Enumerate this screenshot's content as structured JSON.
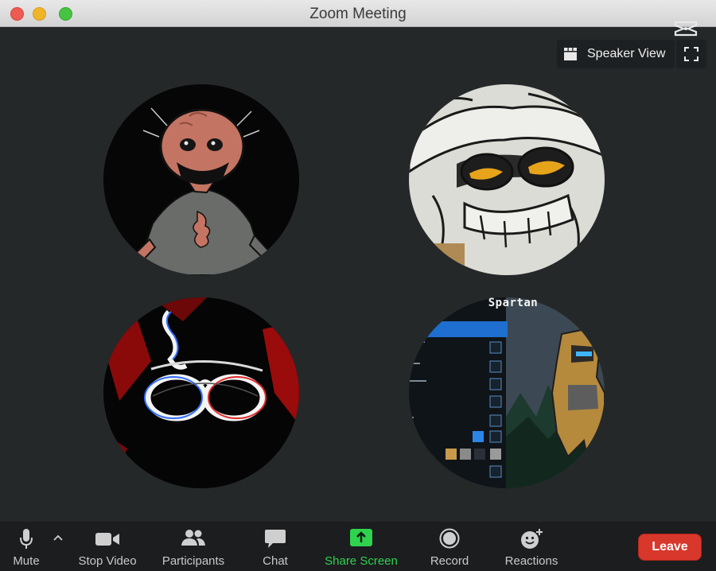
{
  "window": {
    "title": "Zoom Meeting"
  },
  "top_controls": {
    "view_label": "Speaker View"
  },
  "participants": [
    {
      "name": ""
    },
    {
      "name": ""
    },
    {
      "name": ""
    },
    {
      "name": "Spartan"
    }
  ],
  "toolbar": {
    "mute_label": "Mute",
    "video_label": "Stop Video",
    "participants_label": "Participants",
    "chat_label": "Chat",
    "share_label": "Share Screen",
    "record_label": "Record",
    "reactions_label": "Reactions",
    "leave_label": "Leave"
  },
  "colors": {
    "share_accent": "#2fd34e",
    "leave": "#d8372c",
    "background": "#252829"
  },
  "icons": [
    "microphone-icon",
    "chevron-up-icon",
    "video-camera-icon",
    "participants-icon",
    "chat-bubble-icon",
    "share-screen-icon",
    "record-icon",
    "reactions-icon",
    "grid-icon",
    "fullscreen-icon",
    "capcut-logo-icon"
  ]
}
